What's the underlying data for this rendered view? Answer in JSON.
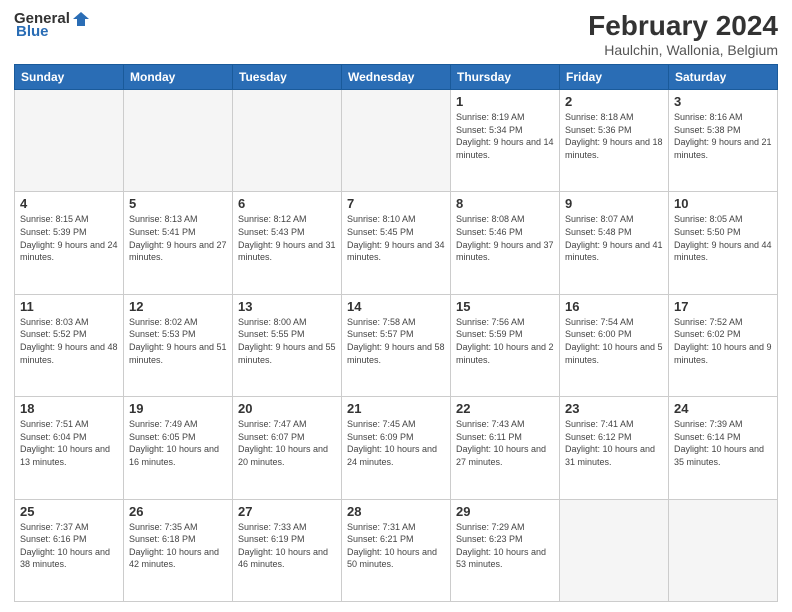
{
  "logo": {
    "general": "General",
    "blue": "Blue"
  },
  "title": "February 2024",
  "subtitle": "Haulchin, Wallonia, Belgium",
  "days_header": [
    "Sunday",
    "Monday",
    "Tuesday",
    "Wednesday",
    "Thursday",
    "Friday",
    "Saturday"
  ],
  "weeks": [
    [
      {
        "day": "",
        "info": ""
      },
      {
        "day": "",
        "info": ""
      },
      {
        "day": "",
        "info": ""
      },
      {
        "day": "",
        "info": ""
      },
      {
        "day": "1",
        "info": "Sunrise: 8:19 AM\nSunset: 5:34 PM\nDaylight: 9 hours and 14 minutes."
      },
      {
        "day": "2",
        "info": "Sunrise: 8:18 AM\nSunset: 5:36 PM\nDaylight: 9 hours and 18 minutes."
      },
      {
        "day": "3",
        "info": "Sunrise: 8:16 AM\nSunset: 5:38 PM\nDaylight: 9 hours and 21 minutes."
      }
    ],
    [
      {
        "day": "4",
        "info": "Sunrise: 8:15 AM\nSunset: 5:39 PM\nDaylight: 9 hours and 24 minutes."
      },
      {
        "day": "5",
        "info": "Sunrise: 8:13 AM\nSunset: 5:41 PM\nDaylight: 9 hours and 27 minutes."
      },
      {
        "day": "6",
        "info": "Sunrise: 8:12 AM\nSunset: 5:43 PM\nDaylight: 9 hours and 31 minutes."
      },
      {
        "day": "7",
        "info": "Sunrise: 8:10 AM\nSunset: 5:45 PM\nDaylight: 9 hours and 34 minutes."
      },
      {
        "day": "8",
        "info": "Sunrise: 8:08 AM\nSunset: 5:46 PM\nDaylight: 9 hours and 37 minutes."
      },
      {
        "day": "9",
        "info": "Sunrise: 8:07 AM\nSunset: 5:48 PM\nDaylight: 9 hours and 41 minutes."
      },
      {
        "day": "10",
        "info": "Sunrise: 8:05 AM\nSunset: 5:50 PM\nDaylight: 9 hours and 44 minutes."
      }
    ],
    [
      {
        "day": "11",
        "info": "Sunrise: 8:03 AM\nSunset: 5:52 PM\nDaylight: 9 hours and 48 minutes."
      },
      {
        "day": "12",
        "info": "Sunrise: 8:02 AM\nSunset: 5:53 PM\nDaylight: 9 hours and 51 minutes."
      },
      {
        "day": "13",
        "info": "Sunrise: 8:00 AM\nSunset: 5:55 PM\nDaylight: 9 hours and 55 minutes."
      },
      {
        "day": "14",
        "info": "Sunrise: 7:58 AM\nSunset: 5:57 PM\nDaylight: 9 hours and 58 minutes."
      },
      {
        "day": "15",
        "info": "Sunrise: 7:56 AM\nSunset: 5:59 PM\nDaylight: 10 hours and 2 minutes."
      },
      {
        "day": "16",
        "info": "Sunrise: 7:54 AM\nSunset: 6:00 PM\nDaylight: 10 hours and 5 minutes."
      },
      {
        "day": "17",
        "info": "Sunrise: 7:52 AM\nSunset: 6:02 PM\nDaylight: 10 hours and 9 minutes."
      }
    ],
    [
      {
        "day": "18",
        "info": "Sunrise: 7:51 AM\nSunset: 6:04 PM\nDaylight: 10 hours and 13 minutes."
      },
      {
        "day": "19",
        "info": "Sunrise: 7:49 AM\nSunset: 6:05 PM\nDaylight: 10 hours and 16 minutes."
      },
      {
        "day": "20",
        "info": "Sunrise: 7:47 AM\nSunset: 6:07 PM\nDaylight: 10 hours and 20 minutes."
      },
      {
        "day": "21",
        "info": "Sunrise: 7:45 AM\nSunset: 6:09 PM\nDaylight: 10 hours and 24 minutes."
      },
      {
        "day": "22",
        "info": "Sunrise: 7:43 AM\nSunset: 6:11 PM\nDaylight: 10 hours and 27 minutes."
      },
      {
        "day": "23",
        "info": "Sunrise: 7:41 AM\nSunset: 6:12 PM\nDaylight: 10 hours and 31 minutes."
      },
      {
        "day": "24",
        "info": "Sunrise: 7:39 AM\nSunset: 6:14 PM\nDaylight: 10 hours and 35 minutes."
      }
    ],
    [
      {
        "day": "25",
        "info": "Sunrise: 7:37 AM\nSunset: 6:16 PM\nDaylight: 10 hours and 38 minutes."
      },
      {
        "day": "26",
        "info": "Sunrise: 7:35 AM\nSunset: 6:18 PM\nDaylight: 10 hours and 42 minutes."
      },
      {
        "day": "27",
        "info": "Sunrise: 7:33 AM\nSunset: 6:19 PM\nDaylight: 10 hours and 46 minutes."
      },
      {
        "day": "28",
        "info": "Sunrise: 7:31 AM\nSunset: 6:21 PM\nDaylight: 10 hours and 50 minutes."
      },
      {
        "day": "29",
        "info": "Sunrise: 7:29 AM\nSunset: 6:23 PM\nDaylight: 10 hours and 53 minutes."
      },
      {
        "day": "",
        "info": ""
      },
      {
        "day": "",
        "info": ""
      }
    ]
  ]
}
